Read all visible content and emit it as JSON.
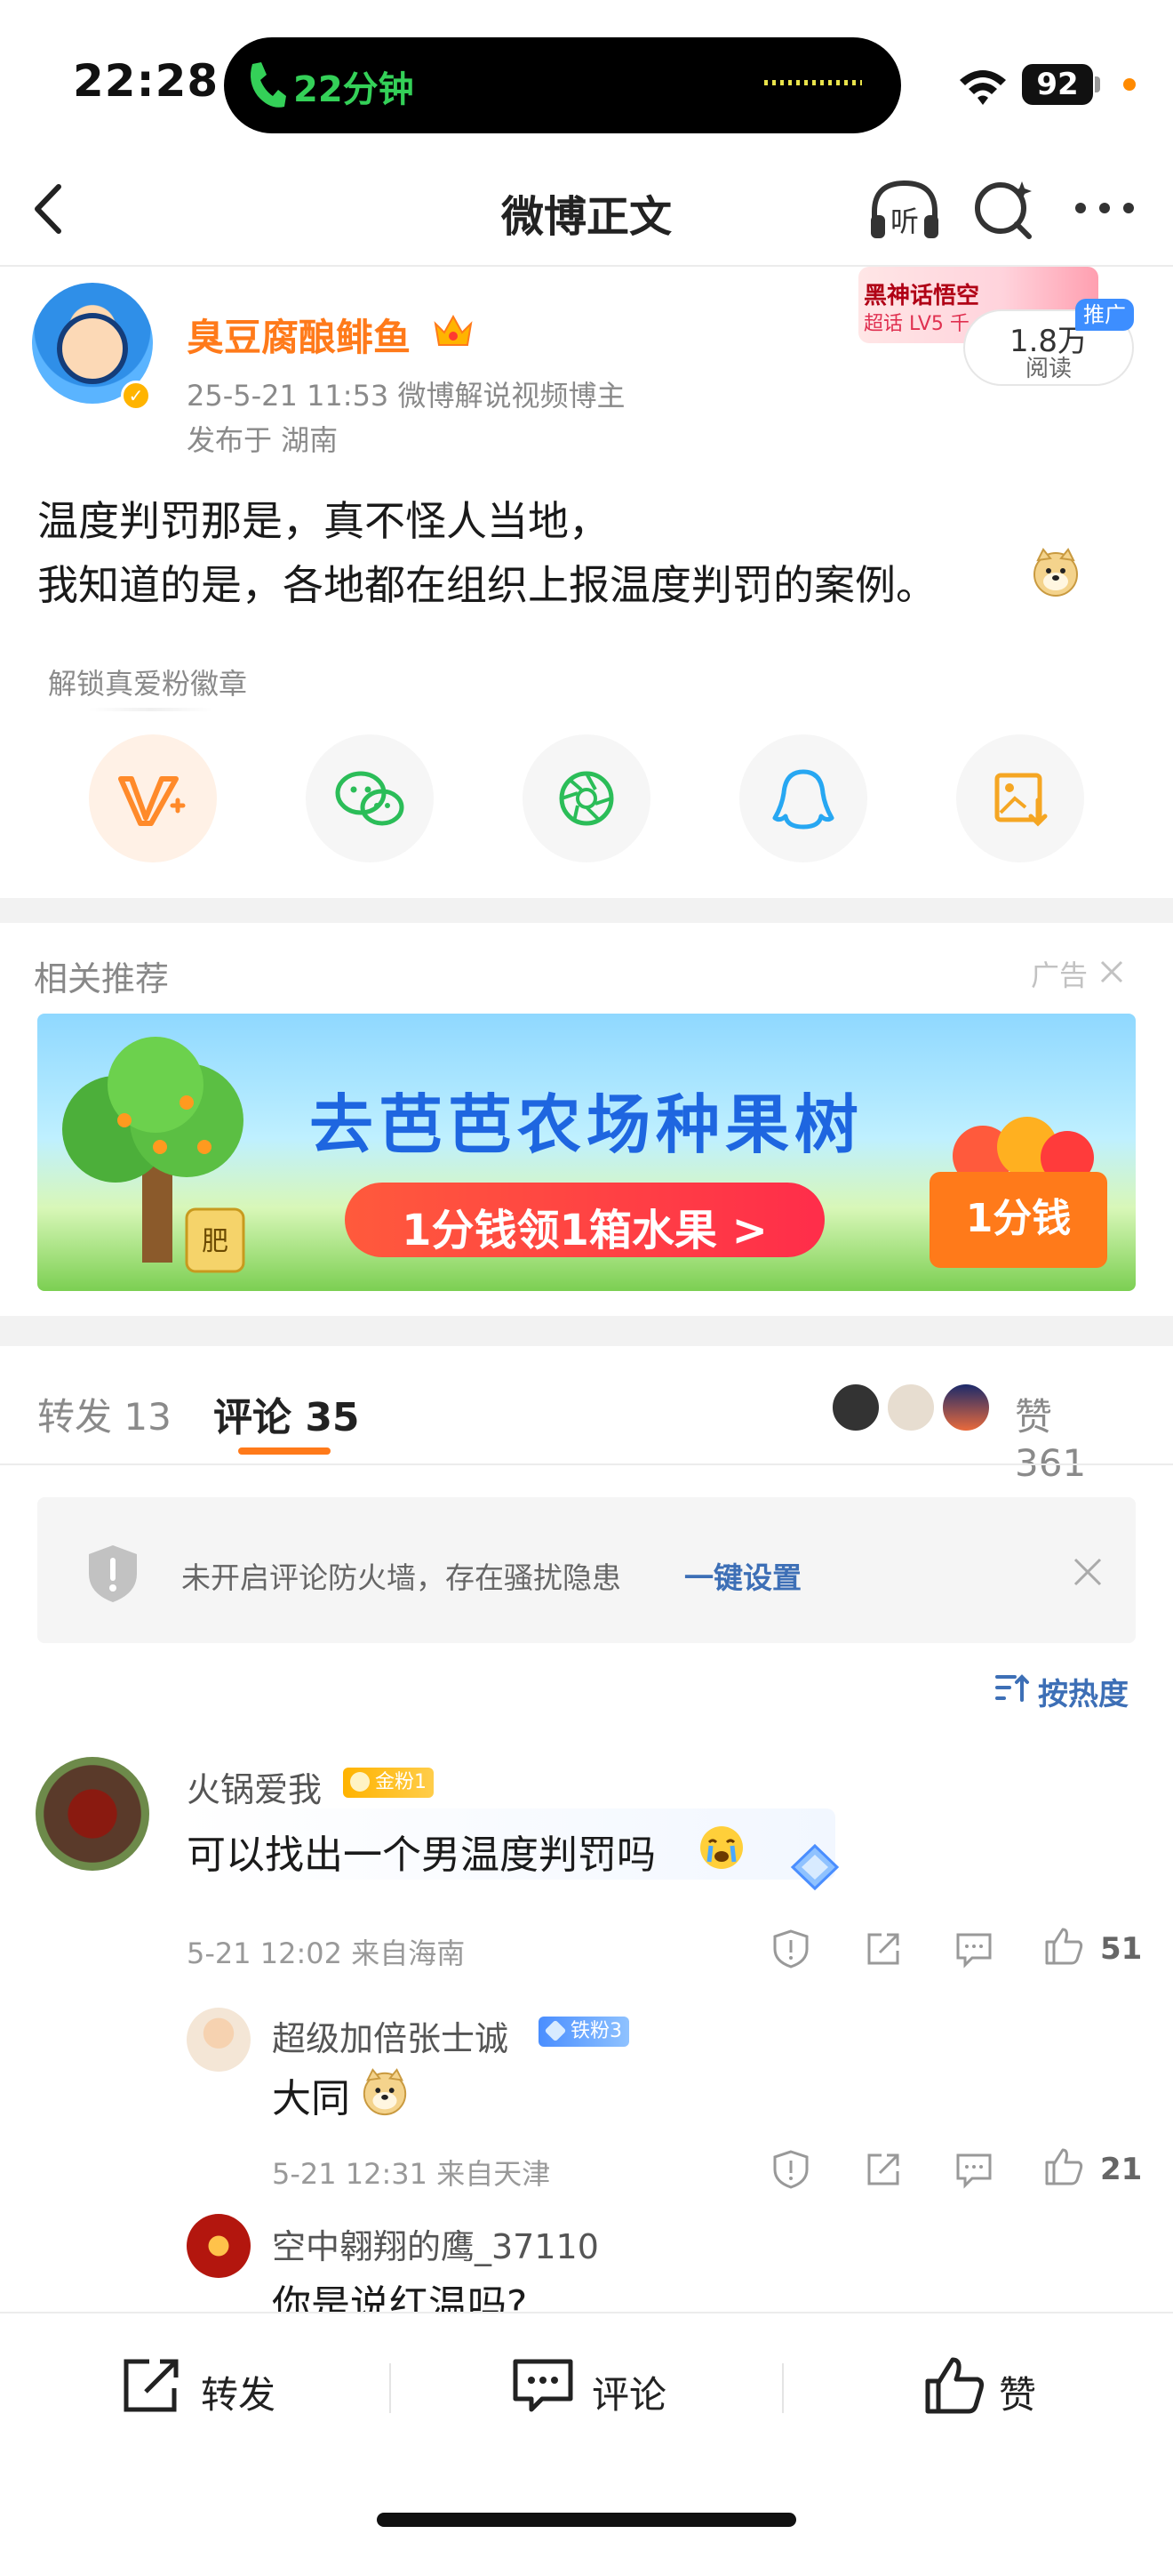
{
  "status_bar": {
    "time": "22:28",
    "call_duration": "22分钟",
    "battery": "92"
  },
  "nav": {
    "title": "微博正文",
    "listen_label": "听"
  },
  "post": {
    "author": "臭豆腐酿鲱鱼",
    "timestamp": "25-5-21 11:53",
    "author_tag": "微博解说视频博主",
    "location": "发布于 湖南",
    "text_line1": "温度判罚那是，真不怪人当地，",
    "text_line2": "我知道的是，各地都在组织上报温度判罚的案例。",
    "fan_banner_title": "黑神话悟空",
    "fan_banner_sub": "超话 LV5 千",
    "read_count": "1.8万",
    "read_label": "阅读",
    "promo_tag": "推广"
  },
  "share": {
    "unlock_text": "解锁真爱粉徽章",
    "buttons": [
      "fan-badge",
      "wechat",
      "moments",
      "qq",
      "save-image"
    ]
  },
  "recommend": {
    "title": "相关推荐",
    "ad_label": "广告",
    "headline": "去芭芭农场种果树",
    "pill_text": "1分钱领1箱水果 >",
    "box_text": "1分钱",
    "jar_text": "肥"
  },
  "tabs": {
    "repost": "转发 13",
    "comment": "评论 35",
    "like": "赞 361"
  },
  "firewall": {
    "text": "未开启评论防火墙，存在骚扰隐患",
    "link": "一键设置"
  },
  "sort": {
    "label": "按热度"
  },
  "comments": [
    {
      "name": "火锅爱我",
      "badge": "金粉1",
      "text": "可以找出一个男温度判罚吗",
      "meta": "5-21 12:02  来自海南",
      "likes": "51"
    }
  ],
  "replies": [
    {
      "name": "超级加倍张士诚",
      "badge": "铁粉3",
      "text": "大同",
      "meta": "5-21 12:31  来自天津",
      "likes": "21"
    },
    {
      "name": "空中翱翔的鹰_37110",
      "text": "你是说红温吗?"
    }
  ],
  "bottom_bar": {
    "repost": "转发",
    "comment": "评论",
    "like": "赞"
  },
  "colors": {
    "accent_orange": "#ff7a1a",
    "link_blue": "#3d6fb6",
    "call_green": "#34d058"
  }
}
